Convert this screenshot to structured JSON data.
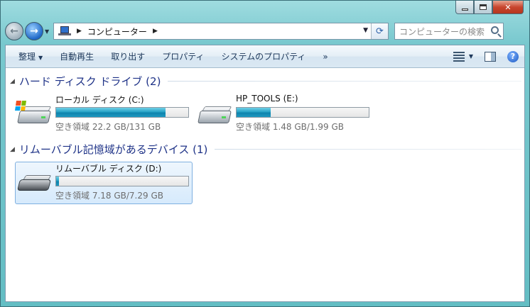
{
  "address": {
    "crumbs": [
      "コンピューター"
    ]
  },
  "search": {
    "placeholder": "コンピューターの検索"
  },
  "toolbar": {
    "organize": "整理",
    "autoplay": "自動再生",
    "eject": "取り出す",
    "properties": "プロパティ",
    "system_properties": "システムのプロパティ",
    "more": "»"
  },
  "groups": {
    "hdd": {
      "title": "ハード ディスク ドライブ (2)",
      "drives": [
        {
          "name": "ローカル ディスク (C:)",
          "free_text": "空き領域 22.2 GB/131 GB",
          "used_fraction": 0.83,
          "icon": "windows-hdd-icon"
        },
        {
          "name": "HP_TOOLS (E:)",
          "free_text": "空き領域 1.48 GB/1.99 GB",
          "used_fraction": 0.26,
          "icon": "hdd-icon"
        }
      ]
    },
    "removable": {
      "title": "リムーバブル記憶域があるデバイス (1)",
      "drives": [
        {
          "name": "リムーバブル ディスク (D:)",
          "free_text": "空き領域 7.18 GB/7.29 GB",
          "used_fraction": 0.02,
          "icon": "removable-disk-icon"
        }
      ]
    }
  },
  "colors": {
    "bar_fill": "#1e98c0",
    "group_title": "#1e3287"
  }
}
